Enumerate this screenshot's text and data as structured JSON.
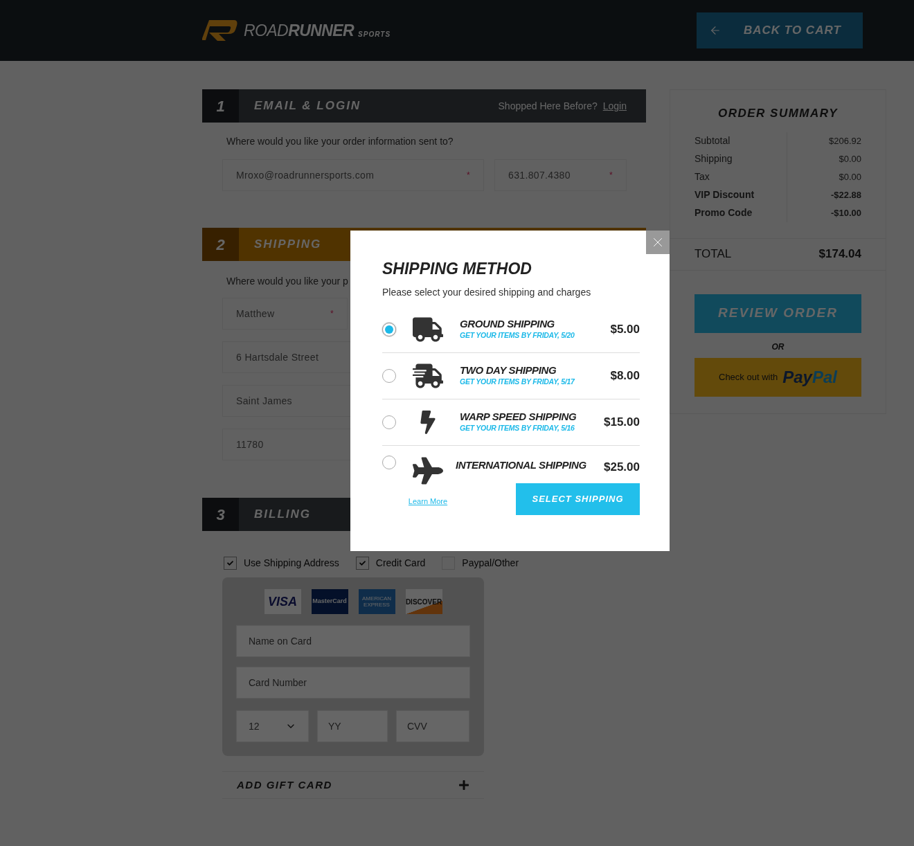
{
  "header": {
    "logo": "ROAD**RUNNER**",
    "logo_tag": "SPORTS",
    "back_button": "BACK TO CART"
  },
  "sections": [
    {
      "number": "1",
      "title": "EMAIL & LOGIN",
      "active": false,
      "login_prompt": "Shopped Here Before?",
      "login_link": "Login",
      "prompt": "Where would you like your order information sent to?",
      "fields": [
        {
          "value": "Mroxo@roadrunnersports.com",
          "required_mark": "*"
        },
        {
          "value": "631.807.4380",
          "required_mark": "*"
        }
      ]
    },
    {
      "number": "2",
      "title": "SHIPPING",
      "active": true,
      "prompt": "Where would you like your p",
      "fields": [
        {
          "value": "Matthew",
          "required_mark": "*"
        },
        {
          "value": "6 Hartsdale Street"
        },
        {
          "value": "Saint James"
        },
        {
          "value": "11780"
        }
      ]
    },
    {
      "number": "3",
      "title": "BILLING",
      "active": false
    }
  ],
  "billing": {
    "checkboxes": [
      {
        "label": "Use Shipping Address",
        "checked": true
      },
      {
        "label": "Credit Card",
        "checked": true
      },
      {
        "label": "Paypal/Other",
        "checked": false
      }
    ],
    "cards": [
      {
        "label": "VISA"
      },
      {
        "label": "MasterCard"
      },
      {
        "label": "AMERICAN EXPRESS"
      },
      {
        "label": "DISCOVER"
      }
    ],
    "name_field": {
      "placeholder": "Name on Card"
    },
    "number_field": {
      "placeholder": "Card Number"
    },
    "month_select": {
      "value": "12"
    },
    "year_field": {
      "placeholder": "YY"
    },
    "cvv_field": {
      "placeholder": "CVV"
    },
    "gift_card": "ADD GIFT CARD"
  },
  "summary": {
    "title": "ORDER SUMMARY",
    "rows": [
      {
        "label": "Subtotal",
        "value": "$206.92",
        "bold": false
      },
      {
        "label": "Shipping",
        "value": "$0.00",
        "bold": false
      },
      {
        "label": "Tax",
        "value": "$0.00",
        "bold": false
      },
      {
        "label": "VIP Discount",
        "value": "-$22.88",
        "bold": true
      },
      {
        "label": "Promo Code",
        "value": "-$10.00",
        "bold": true
      }
    ],
    "total_label": "TOTAL",
    "total_value": "$174.04",
    "review_button": "REVIEW ORDER",
    "or": "OR",
    "paypal_prefix": "Check out with",
    "paypal_brand": [
      "Pay",
      "Pal"
    ]
  },
  "modal": {
    "title": "SHIPPING METHOD",
    "subtitle": "Please select your desired shipping and charges",
    "options": [
      {
        "kind": "truck",
        "name": "GROUND SHIPPING",
        "eta": "GET YOUR ITEMS BY FRIDAY, 5/20",
        "price": "$5.00",
        "selected": true
      },
      {
        "kind": "fast-truck",
        "name": "TWO DAY SHIPPING",
        "eta": "GET YOUR ITEMS BY FRIDAY, 5/17",
        "price": "$8.00",
        "selected": false
      },
      {
        "kind": "bolt",
        "name": "WARP SPEED SHIPPING",
        "eta": "GET YOUR ITEMS BY FRIDAY, 5/16",
        "price": "$15.00",
        "selected": false
      },
      {
        "kind": "plane",
        "name": "INTERNATIONAL SHIPPING",
        "price": "$25.00",
        "selected": false,
        "link": "Learn More"
      }
    ],
    "button": "SELECT SHIPPING"
  }
}
